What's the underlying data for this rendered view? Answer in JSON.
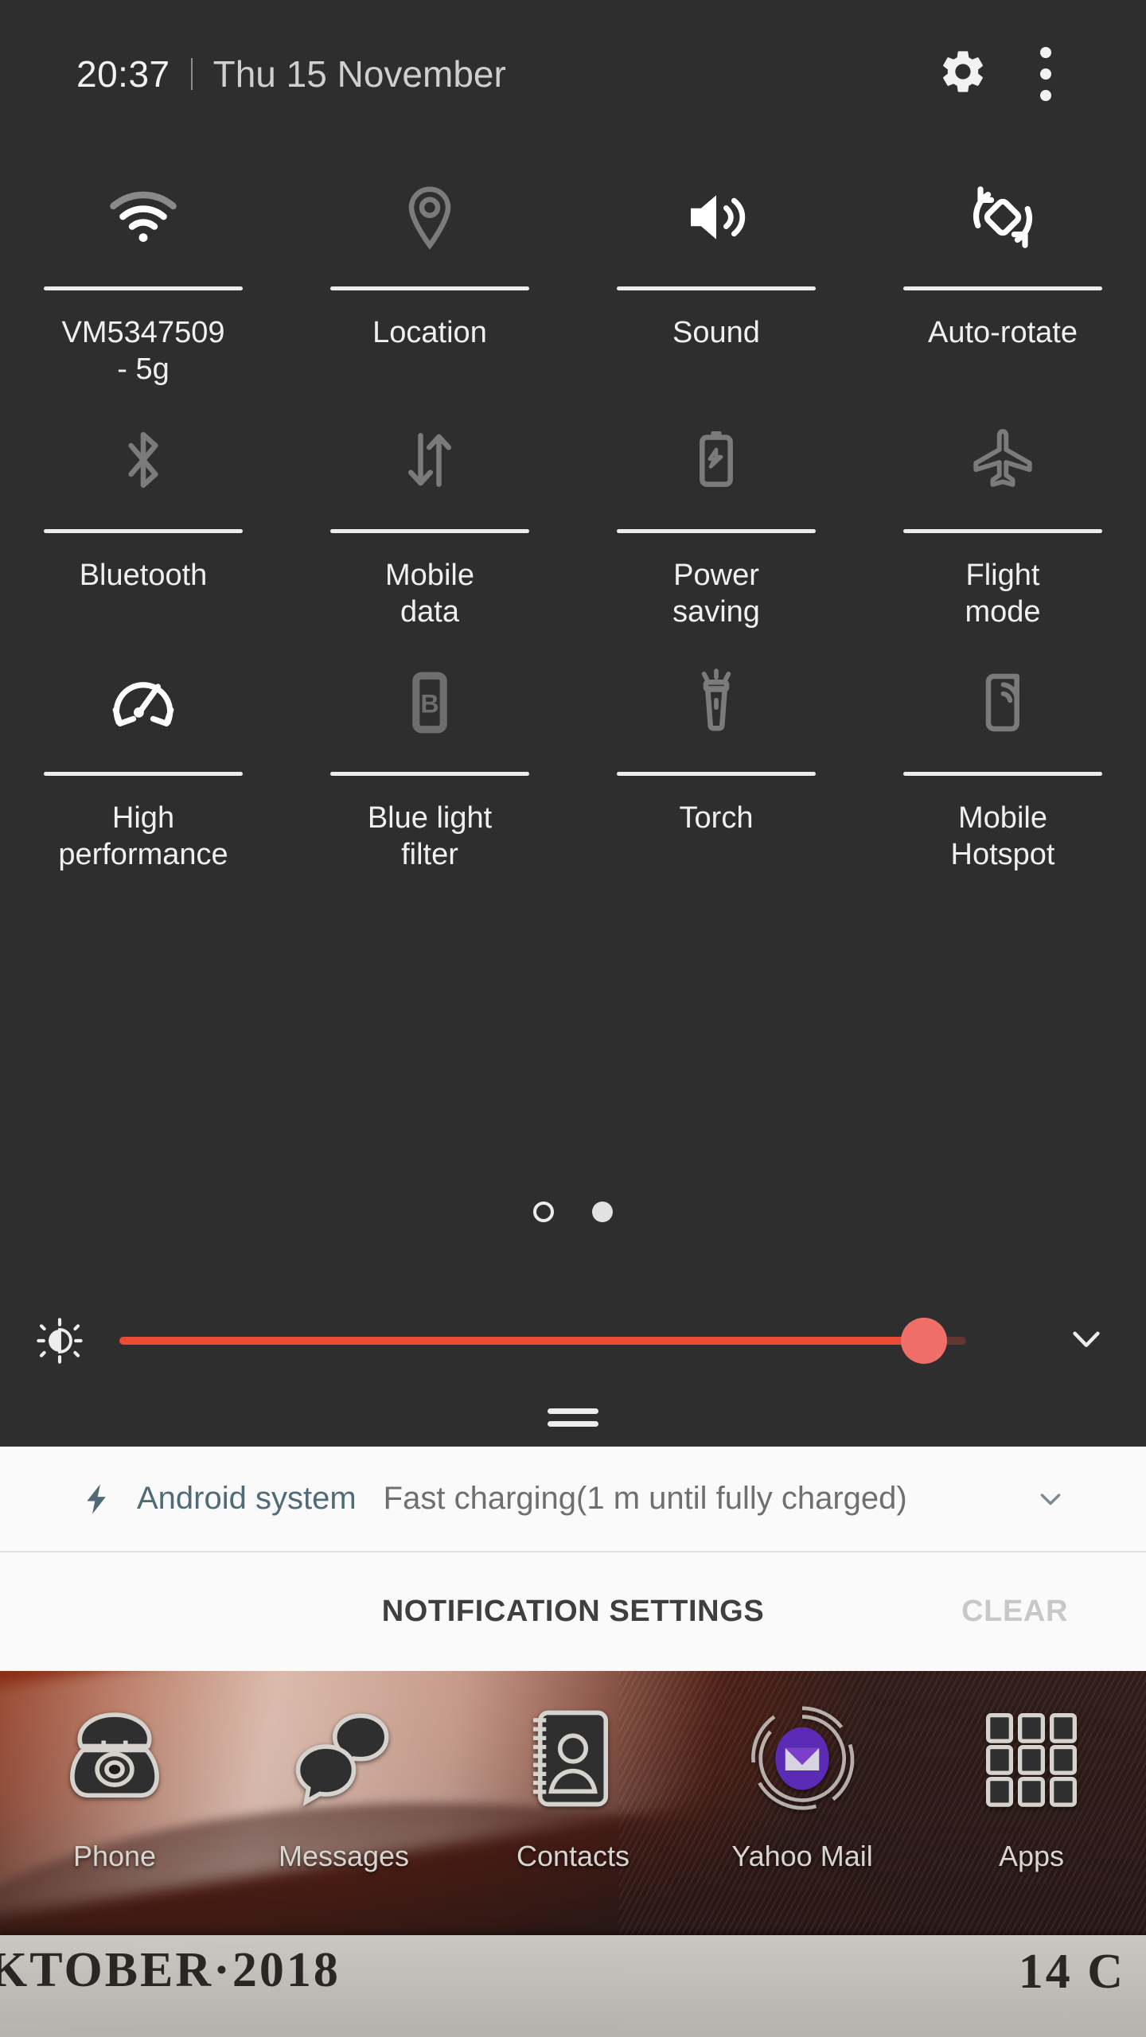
{
  "status_bar": {
    "time": "20:37",
    "date": "Thu 15 November",
    "settings_icon": "gear-icon",
    "overflow_icon": "more-vertical-icon"
  },
  "quick_settings": {
    "tiles": [
      {
        "label": "VM5347509\n- 5g",
        "icon": "wifi-icon",
        "state": "on",
        "name": "wifi"
      },
      {
        "label": "Location",
        "icon": "location-pin-icon",
        "state": "off",
        "name": "location"
      },
      {
        "label": "Sound",
        "icon": "sound-icon",
        "state": "on",
        "name": "sound"
      },
      {
        "label": "Auto-rotate",
        "icon": "auto-rotate-icon",
        "state": "on",
        "name": "auto-rotate"
      },
      {
        "label": "Bluetooth",
        "icon": "bluetooth-icon",
        "state": "off",
        "name": "bluetooth"
      },
      {
        "label": "Mobile\ndata",
        "icon": "mobile-data-icon",
        "state": "off",
        "name": "mobile-data"
      },
      {
        "label": "Power\nsaving",
        "icon": "power-saving-icon",
        "state": "off",
        "name": "power-saving"
      },
      {
        "label": "Flight\nmode",
        "icon": "airplane-icon",
        "state": "off",
        "name": "flight-mode"
      },
      {
        "label": "High\nperformance",
        "icon": "speedometer-icon",
        "state": "on",
        "name": "high-performance"
      },
      {
        "label": "Blue light\nfilter",
        "icon": "blue-light-icon",
        "state": "off",
        "name": "blue-light-filter"
      },
      {
        "label": "Torch",
        "icon": "torch-icon",
        "state": "off",
        "name": "torch"
      },
      {
        "label": "Mobile\nHotspot",
        "icon": "hotspot-icon",
        "state": "off",
        "name": "mobile-hotspot"
      }
    ],
    "pagination": {
      "total_pages": 2,
      "current_page": 2
    },
    "brightness": {
      "icon": "brightness-icon",
      "value_percent": 95,
      "track_color": "#ed4a35",
      "thumb_color": "#ef6f68",
      "expand_icon": "chevron-down-icon"
    },
    "drag_handle": "handle-bars"
  },
  "notifications": {
    "items": [
      {
        "icon": "charging-bolt-icon",
        "app": "Android system",
        "text": "Fast charging(1 m until fully charged)",
        "expand_icon": "chevron-down-icon",
        "app_color": "#4f6b78"
      }
    ],
    "settings_button": "NOTIFICATION SETTINGS",
    "clear_button": "CLEAR"
  },
  "home_screen": {
    "dock": [
      {
        "label": "Phone",
        "icon": "telephone-icon"
      },
      {
        "label": "Messages",
        "icon": "speech-bubbles-icon"
      },
      {
        "label": "Contacts",
        "icon": "contact-book-icon"
      },
      {
        "label": "Yahoo Mail",
        "icon": "envelope-icon",
        "accent": "#5b2bb5"
      },
      {
        "label": "Apps",
        "icon": "app-grid-icon"
      }
    ],
    "wallpaper_text_left": "KTOBER·2018",
    "wallpaper_text_right": "14 C"
  }
}
